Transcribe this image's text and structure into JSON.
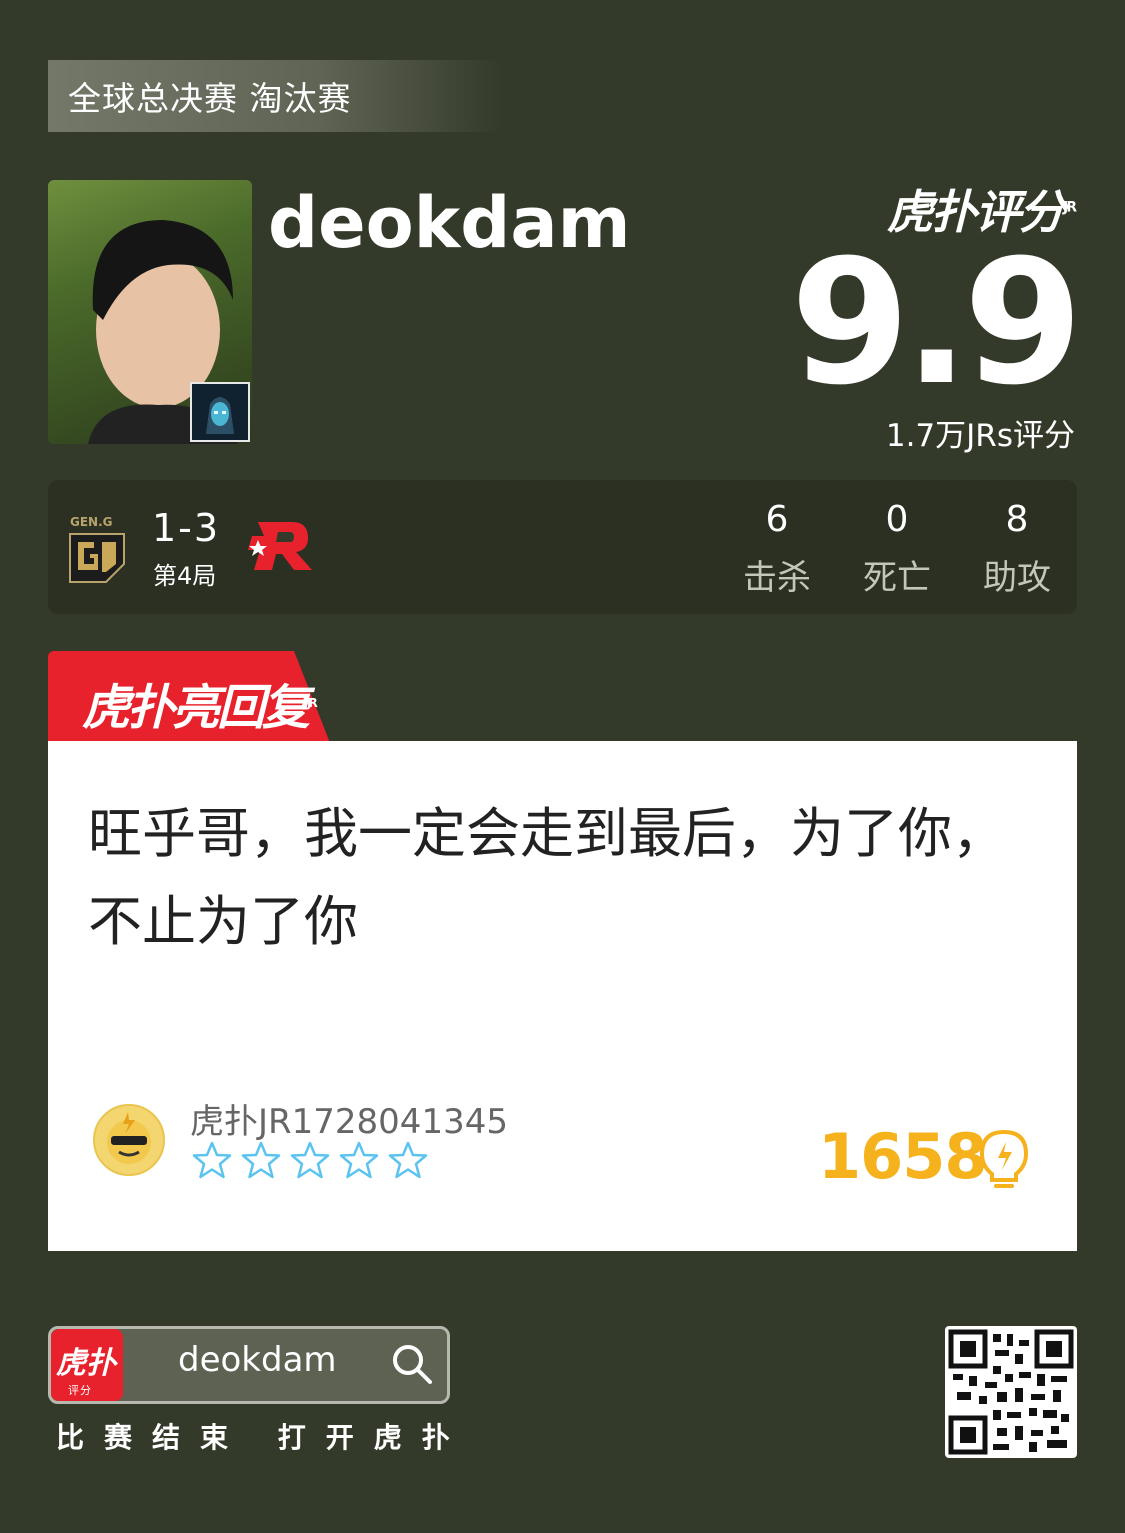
{
  "stage": "全球总决赛 淘汰赛",
  "player": {
    "name": "deokdam",
    "avatar_icon": "player-photo",
    "champion_icon": "champion-portrait-icon"
  },
  "rating": {
    "logo": "虎扑评分",
    "logo_sup": "JR",
    "score": "9.9",
    "votes": "1.7万JRs评分"
  },
  "match": {
    "team_left_logo": "gen-g-logo",
    "team_right_logo": "kt-rolster-logo",
    "series_score": "1-3",
    "game_label": "第4局",
    "stats": [
      {
        "value": "6",
        "label": "击杀"
      },
      {
        "value": "0",
        "label": "死亡"
      },
      {
        "value": "8",
        "label": "助攻"
      }
    ]
  },
  "highlight": {
    "tab_label": "虎扑亮回复",
    "tab_sup": "JR",
    "text": "旺乎哥，我一定会走到最后，为了你，不止为了你",
    "username": "虎扑JR1728041345",
    "stars": 5,
    "light_count": "1658",
    "light_icon": "lightbulb-icon"
  },
  "footer": {
    "app_icon_text": "虎扑",
    "app_icon_sub": "评分",
    "search_text": "deokdam",
    "cta": "比赛结束 打开虎扑",
    "qr_icon": "qr-code"
  },
  "colors": {
    "background": "#343a2a",
    "accent_red": "#e8222c",
    "light_orange": "#f5b21c",
    "star_blue": "#5bc3f0"
  }
}
